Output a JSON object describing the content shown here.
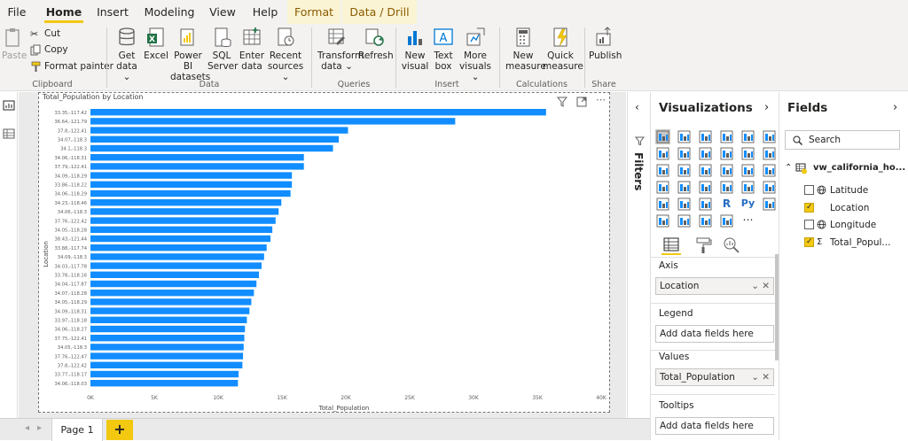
{
  "menu": {
    "tabs": [
      "File",
      "Home",
      "Insert",
      "Modeling",
      "View",
      "Help",
      "Format",
      "Data / Drill"
    ],
    "active": "Home"
  },
  "ribbon": {
    "clipboard": {
      "paste": "Paste",
      "cut": "Cut",
      "copy": "Copy",
      "format_painter": "Format painter",
      "label": "Clipboard"
    },
    "data": {
      "get_data": "Get data",
      "excel": "Excel",
      "power_bi": "Power BI datasets",
      "sql": "SQL Server",
      "enter": "Enter data",
      "recent": "Recent sources",
      "label": "Data"
    },
    "queries": {
      "transform": "Transform data",
      "refresh": "Refresh",
      "label": "Queries"
    },
    "insert": {
      "new_visual": "New visual",
      "text_box": "Text box",
      "more_visuals": "More visuals",
      "label": "Insert"
    },
    "calculations": {
      "new_measure": "New measure",
      "quick_measure": "Quick measure",
      "label": "Calculations"
    },
    "share": {
      "publish": "Publish",
      "label": "Share"
    }
  },
  "filters": {
    "label": "Filters"
  },
  "visualizations": {
    "title": "Visualizations",
    "axis_label": "Axis",
    "axis_value": "Location",
    "legend_label": "Legend",
    "legend_placeholder": "Add data fields here",
    "values_label": "Values",
    "values_value": "Total_Population",
    "tooltips_label": "Tooltips",
    "tooltips_placeholder": "Add data fields here"
  },
  "fields": {
    "title": "Fields",
    "search_placeholder": "Search",
    "table_name": "vw_california_ho...",
    "items": [
      {
        "name": "Latitude",
        "checked": false,
        "icon": "globe-icon"
      },
      {
        "name": "Location",
        "checked": true,
        "icon": "none"
      },
      {
        "name": "Longitude",
        "checked": false,
        "icon": "globe-icon"
      },
      {
        "name": "Total_Popul...",
        "checked": true,
        "icon": "sigma-icon"
      }
    ]
  },
  "pages": {
    "current": "Page 1",
    "add": "+"
  },
  "colors": {
    "bar": "#118dff",
    "accent": "#f2c811"
  },
  "chart_data": {
    "type": "bar",
    "orientation": "horizontal",
    "title": "Total_Population by Location",
    "xlabel": "Total_Population",
    "ylabel": "Location",
    "xlim": [
      0,
      40000
    ],
    "xticks": [
      "0K",
      "5K",
      "10K",
      "15K",
      "20K",
      "25K",
      "30K",
      "35K",
      "40K"
    ],
    "categories": [
      "33.35,-117.42",
      "36.64,-121.79",
      "37.8,-122.41",
      "34.07,-118.3",
      "34.1,-118.3",
      "34.06,-118.31",
      "37.79,-122.41",
      "34.09,-118.29",
      "33.86,-118.22",
      "34.06,-118.29",
      "34.23,-118.46",
      "34.06,-118.3",
      "37.76,-122.42",
      "34.05,-118.28",
      "38.43,-121.44",
      "33.88,-117.74",
      "34.09,-118.3",
      "34.03,-117.78",
      "33.78,-118.16",
      "34.04,-117.87",
      "34.07,-118.28",
      "34.05,-118.29",
      "34.09,-118.31",
      "33.97,-118.18",
      "34.06,-118.27",
      "37.75,-122.41",
      "34.05,-118.3",
      "37.76,-122.47",
      "37.8,-122.42",
      "33.77,-118.17",
      "34.06,-118.03"
    ],
    "values": [
      35682,
      28566,
      20173,
      19448,
      18996,
      16716,
      16716,
      15775,
      15775,
      15670,
      14950,
      14738,
      14500,
      14245,
      14100,
      13800,
      13600,
      13400,
      13200,
      13000,
      12800,
      12600,
      12450,
      12250,
      12100,
      12050,
      12000,
      11950,
      11900,
      11600,
      11550
    ]
  }
}
